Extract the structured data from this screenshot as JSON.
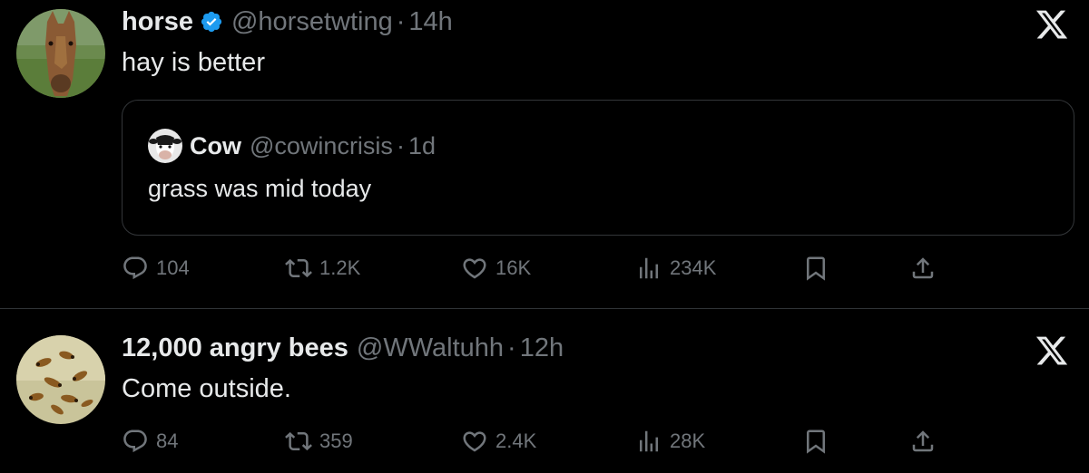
{
  "tweets": [
    {
      "name": "horse",
      "verified": true,
      "handle": "@horsetwting",
      "separator": "·",
      "time": "14h",
      "text": "hay is better",
      "quote": {
        "name": "Cow",
        "handle": "@cowincrisis",
        "separator": "·",
        "time": "1d",
        "text": "grass was mid today"
      },
      "stats": {
        "replies": "104",
        "reposts": "1.2K",
        "likes": "16K",
        "views": "234K"
      }
    },
    {
      "name": "12,000 angry bees",
      "verified": false,
      "handle": "@WWaltuhh",
      "separator": "·",
      "time": "12h",
      "text": "Come outside.",
      "stats": {
        "replies": "84",
        "reposts": "359",
        "likes": "2.4K",
        "views": "28K"
      }
    }
  ],
  "colors": {
    "background": "#000000",
    "text": "#e7e9ea",
    "muted": "#71767b",
    "verified": "#1d9bf0",
    "border": "#2f3336"
  },
  "icons": [
    "x-logo-icon",
    "verified-badge-icon",
    "reply-icon",
    "repost-icon",
    "like-icon",
    "views-icon",
    "bookmark-icon",
    "share-icon"
  ]
}
